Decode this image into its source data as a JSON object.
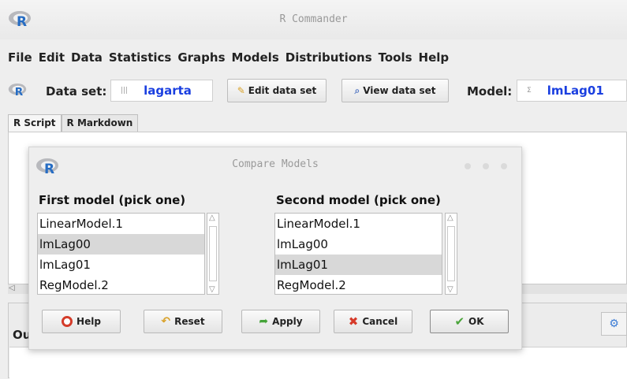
{
  "window": {
    "title": "R Commander"
  },
  "menubar": {
    "items": [
      "File",
      "Edit",
      "Data",
      "Statistics",
      "Graphs",
      "Models",
      "Distributions",
      "Tools",
      "Help"
    ]
  },
  "toolbar": {
    "dataset_label": "Data set:",
    "dataset_value": "lagarta",
    "edit_label": "Edit data set",
    "view_label": "View data set",
    "model_label": "Model:",
    "model_value": "lmLag01"
  },
  "tabs": [
    "R Script",
    "R Markdown"
  ],
  "output": {
    "label": "Ou"
  },
  "dialog": {
    "title": "Compare Models",
    "first_label": "First model (pick one)",
    "second_label": "Second model (pick one)",
    "first_models": [
      "LinearModel.1",
      "lmLag00",
      "lmLag01",
      "RegModel.2"
    ],
    "second_models": [
      "LinearModel.1",
      "lmLag00",
      "lmLag01",
      "RegModel.2"
    ],
    "first_selected": "lmLag00",
    "second_selected": "lmLag01",
    "buttons": {
      "help": "Help",
      "reset": "Reset",
      "apply": "Apply",
      "cancel": "Cancel",
      "ok": "OK"
    }
  },
  "colors": {
    "accent_text": "#1a3fe0",
    "r_logo": "#276dc3"
  }
}
